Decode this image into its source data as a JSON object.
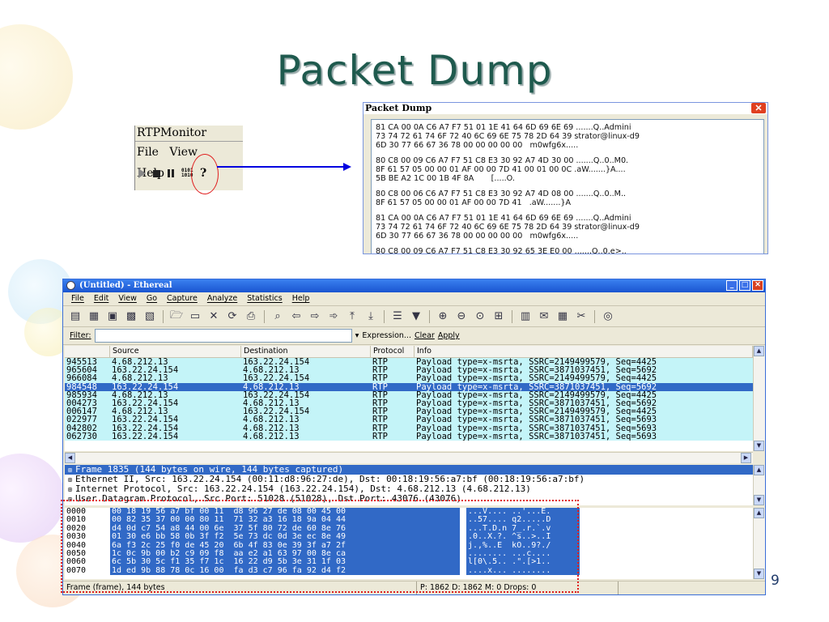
{
  "slide": {
    "title": "Packet Dump",
    "page_number": "9"
  },
  "rtp_monitor": {
    "title": "RTPMonitor",
    "menus": [
      "File",
      "View",
      "Help"
    ],
    "dump_icon_text": "0101\n1010"
  },
  "packet_dump": {
    "title": "Packet Dump",
    "close_glyph": "✕",
    "blocks": [
      "81 CA 00 0A C6 A7 F7 51 01 1E 41 64 6D 69 6E 69 .......Q..Admini\n73 74 72 61 74 6F 72 40 6C 69 6E 75 78 2D 64 39 strator@linux-d9\n6D 30 77 66 67 36 78 00 00 00 00 00   m0wfg6x.....",
      "80 C8 00 09 C6 A7 F7 51 C8 E3 30 92 A7 4D 30 00 .......Q..0..M0.\n8F 61 57 05 00 00 01 AF 00 00 7D 41 00 01 00 0C .aW.......}A....\n5B BE A2 1C 00 1B 4F 8A       [.....O.",
      "80 C8 00 06 C6 A7 F7 51 C8 E3 30 92 A7 4D 08 00 .......Q..0..M..\n8F 61 57 05 00 00 01 AF 00 00 7D 41   .aW.......}A",
      "81 CA 00 0A C6 A7 F7 51 01 1E 41 64 6D 69 6E 69 .......Q..Admini\n73 74 72 61 74 6F 72 40 6C 69 6E 75 78 2D 64 39 strator@linux-d9\n6D 30 77 66 67 36 78 00 00 00 00 00   m0wfg6x.....",
      "80 C8 00 09 C6 A7 F7 51 C8 E3 30 92 65 3E E0 00 .......Q..0.e>.."
    ]
  },
  "ethereal": {
    "window_title": "(Untitled) - Ethereal",
    "menu": [
      "File",
      "Edit",
      "View",
      "Go",
      "Capture",
      "Analyze",
      "Statistics",
      "Help"
    ],
    "filter": {
      "label": "Filter:",
      "value": "",
      "expression_label": "Expression...",
      "clear_label": "Clear",
      "apply_label": "Apply"
    },
    "columns": [
      "",
      "Source",
      "Destination",
      "Protocol",
      "Info"
    ],
    "rows": [
      {
        "no": "945513",
        "src": "4.68.212.13",
        "dst": "163.22.24.154",
        "proto": "RTP",
        "info": "Payload type=x-msrta, SSRC=2149499579, Seq=4425",
        "color": "#c4f4f8",
        "partial": true
      },
      {
        "no": "965604",
        "src": "163.22.24.154",
        "dst": "4.68.212.13",
        "proto": "RTP",
        "info": "Payload type=x-msrta, SSRC=3871037451, Seq=5692",
        "color": "#c4f4f8"
      },
      {
        "no": "966084",
        "src": "4.68.212.13",
        "dst": "163.22.24.154",
        "proto": "RTP",
        "info": "Payload type=x-msrta, SSRC=2149499579, Seq=4425",
        "color": "#c4f4f8"
      },
      {
        "no": "984548",
        "src": "163.22.24.154",
        "dst": "4.68.212.13",
        "proto": "RTP",
        "info": "Payload type=x-msrta, SSRC=3871037451, Seq=5692",
        "color": "#3169c6",
        "selected": true
      },
      {
        "no": "985934",
        "src": "4.68.212.13",
        "dst": "163.22.24.154",
        "proto": "RTP",
        "info": "Payload type=x-msrta, SSRC=2149499579, Seq=4425",
        "color": "#c4f4f8"
      },
      {
        "no": "004273",
        "src": "163.22.24.154",
        "dst": "4.68.212.13",
        "proto": "RTP",
        "info": "Payload type=x-msrta, SSRC=3871037451, Seq=5692",
        "color": "#c4f4f8"
      },
      {
        "no": "006147",
        "src": "4.68.212.13",
        "dst": "163.22.24.154",
        "proto": "RTP",
        "info": "Payload type=x-msrta, SSRC=2149499579, Seq=4425",
        "color": "#c4f4f8"
      },
      {
        "no": "022977",
        "src": "163.22.24.154",
        "dst": "4.68.212.13",
        "proto": "RTP",
        "info": "Payload type=x-msrta, SSRC=3871037451, Seq=5693",
        "color": "#c4f4f8"
      },
      {
        "no": "042802",
        "src": "163.22.24.154",
        "dst": "4.68.212.13",
        "proto": "RTP",
        "info": "Payload type=x-msrta, SSRC=3871037451, Seq=5693",
        "color": "#c4f4f8"
      },
      {
        "no": "062730",
        "src": "163.22.24.154",
        "dst": "4.68.212.13",
        "proto": "RTP",
        "info": "Payload type=x-msrta, SSRC=3871037451, Seq=5693",
        "color": "#c4f4f8"
      }
    ],
    "tree": [
      {
        "text": "Frame 1835 (144 bytes on wire, 144 bytes captured)",
        "selected": true
      },
      {
        "text": "Ethernet II, Src: 163.22.24.154 (00:11:d8:96:27:de), Dst: 00:18:19:56:a7:bf (00:18:19:56:a7:bf)"
      },
      {
        "text": "Internet Protocol, Src: 163.22.24.154 (163.22.24.154), Dst: 4.68.212.13 (4.68.212.13)"
      },
      {
        "text": "User Datagram Protocol, Src Port: 51028 (51028), Dst Port: 43076 (43076)"
      }
    ],
    "hex": [
      {
        "off": "0000",
        "bytes": "00 18 19 56 a7 bf 00 11  d8 96 27 de 08 00 45 00",
        "ascii": "...V.... ..'...E."
      },
      {
        "off": "0010",
        "bytes": "00 82 35 37 00 00 80 11  71 32 a3 16 18 9a 04 44",
        "ascii": "..57.... q2.....D"
      },
      {
        "off": "0020",
        "bytes": "d4 0d c7 54 a8 44 00 6e  37 5f 80 72 de 60 8e 76",
        "ascii": "...T.D.n 7_.r.`.v"
      },
      {
        "off": "0030",
        "bytes": "01 30 e6 bb 58 0b 3f f2  5e 73 dc 0d 3e ec 8e 49",
        "ascii": ".0..X.?. ^s..>..I"
      },
      {
        "off": "0040",
        "bytes": "6a f3 2c 25 f0 de 45 20  6b 4f 83 0e 39 3f a7 2f",
        "ascii": "j.,%..E  kO..9?./"
      },
      {
        "off": "0050",
        "bytes": "1c 0c 9b 00 b2 c9 09 f8  aa e2 a1 63 97 00 8e ca",
        "ascii": "........ ...c...."
      },
      {
        "off": "0060",
        "bytes": "6c 5b 30 5c f1 35 f7 1c  16 22 d9 5b 3e 31 1f 03",
        "ascii": "l[0\\.5.. .\".[>1.."
      },
      {
        "off": "0070",
        "bytes": "1d ed 9b 88 78 0c 16 00  fa d3 c7 96 fa 92 d4 f2",
        "ascii": "....x... ........"
      }
    ],
    "status_left": "Frame (frame), 144 bytes",
    "status_right": "P: 1862 D: 1862 M: 0 Drops: 0"
  },
  "colors": {
    "title_green": "#1f5a4e",
    "selection_blue": "#3169c6",
    "row_cyan": "#c4f4f8",
    "annotation_red": "#e02020",
    "arrow_blue": "#0000e0"
  }
}
